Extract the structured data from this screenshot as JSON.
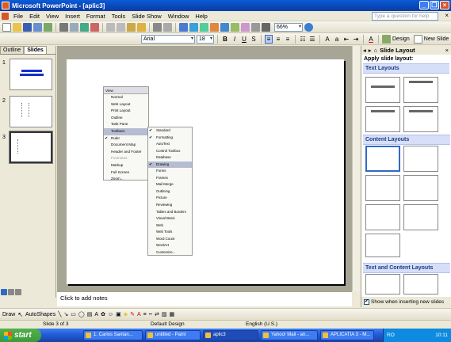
{
  "window": {
    "title": "Microsoft PowerPoint - [aplic3]"
  },
  "menubar": {
    "items": [
      "File",
      "Edit",
      "View",
      "Insert",
      "Format",
      "Tools",
      "Slide Show",
      "Window",
      "Help"
    ],
    "question_placeholder": "Type a question for help"
  },
  "formatting": {
    "font": "Arial",
    "size": "18",
    "zoom": "66%",
    "design_label": "Design",
    "new_slide_label": "New Slide"
  },
  "left_pane": {
    "tabs": [
      "Outline",
      "Slides"
    ],
    "slide_numbers": [
      "1",
      "2",
      "3"
    ]
  },
  "slide_menu": {
    "title": "View",
    "items": [
      {
        "label": "Normal"
      },
      {
        "label": "Web Layout"
      },
      {
        "label": "Print Layout"
      },
      {
        "label": "Outline"
      },
      {
        "label": "Task Pane"
      },
      {
        "label": "Toolbars",
        "highlight": true
      },
      {
        "label": "Ruler",
        "checked": true
      },
      {
        "label": "Document Map"
      },
      {
        "label": "Header and Footer"
      },
      {
        "label": "Footnotes",
        "gray": true
      },
      {
        "label": "Markup"
      },
      {
        "label": "Full Screen"
      },
      {
        "label": "Zoom..."
      }
    ]
  },
  "toolbars_submenu": {
    "items": [
      {
        "label": "Standard",
        "checked": true
      },
      {
        "label": "Formatting",
        "checked": true
      },
      {
        "label": "AutoText"
      },
      {
        "label": "Control Toolbox"
      },
      {
        "label": "Database"
      },
      {
        "label": "Drawing",
        "highlight": true,
        "checked": true
      },
      {
        "label": "Forms"
      },
      {
        "label": "Frames"
      },
      {
        "label": "Mail Merge"
      },
      {
        "label": "Outlining"
      },
      {
        "label": "Picture"
      },
      {
        "label": "Reviewing"
      },
      {
        "label": "Tables and Borders"
      },
      {
        "label": "Visual Basic"
      },
      {
        "label": "Web"
      },
      {
        "label": "Web Tools"
      },
      {
        "label": "Word Count"
      },
      {
        "label": "WordArt"
      },
      {
        "label": "Customize..."
      }
    ]
  },
  "notes": {
    "placeholder": "Click to add notes"
  },
  "task_pane": {
    "title": "Slide Layout",
    "subtitle": "Apply slide layout:",
    "sections": [
      "Text Layouts",
      "Content Layouts",
      "Text and Content Layouts"
    ],
    "footer_checkbox": "Show when inserting new slides"
  },
  "drawbar": {
    "draw_label": "Draw",
    "autoshapes_label": "AutoShapes"
  },
  "status": {
    "slide": "Slide 3 of 3",
    "design": "Default Design",
    "language": "English (U.S.)"
  },
  "taskbar": {
    "start": "start",
    "tasks": [
      "1. Carlos Santan...",
      "untitled - Paint",
      "aplic3",
      "Yahoo! Mail - an...",
      "APLICATIA 3 - M..."
    ],
    "tray_lang": "RO",
    "clock": "10:11"
  },
  "colors": {
    "titlebar": "#0b46b8",
    "slide_bg": "#ffffff",
    "canvas": "#a7a596",
    "taskbar": "#245edb"
  }
}
